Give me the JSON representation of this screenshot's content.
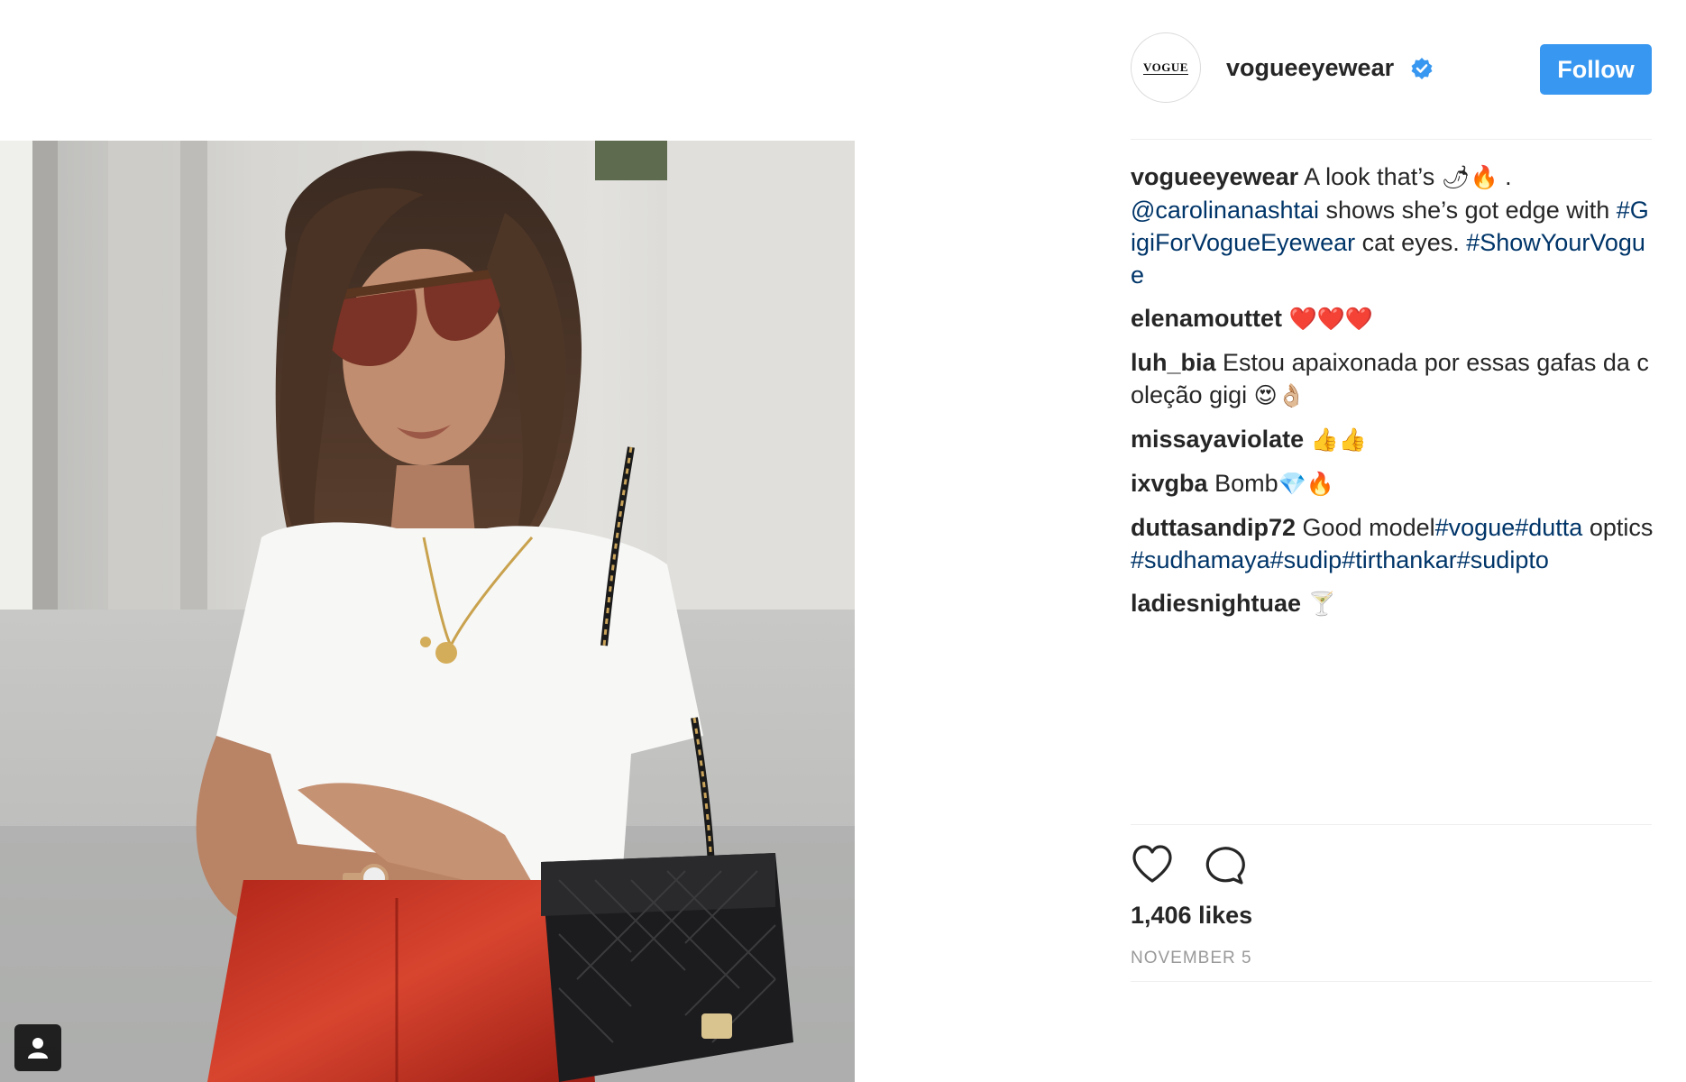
{
  "post": {
    "username": "vogueeyewear",
    "avatar_text": "VOGUE",
    "follow_label": "Follow",
    "caption": {
      "user": "vogueeyewear",
      "text1": "A look that’s",
      "emoji1": "🌶🔥",
      "text2": " .",
      "mention": "@carolinanashtai",
      "text3": " shows she’s got edge with ",
      "hashtag1": "#GigiForVogueEyewear",
      "text4": " cat eyes. ",
      "hashtag2": "#ShowYourVogue"
    },
    "comments": [
      {
        "user": "elenamouttet",
        "text": "",
        "emoji": "❤️❤️❤️"
      },
      {
        "user": "luh_bia",
        "text": "Estou apaixonada por essas gafas da coleção gigi",
        "emoji": "😍👌🏼"
      },
      {
        "user": "missayaviolate",
        "text": "",
        "emoji": "👍👍"
      },
      {
        "user": "ixvgba",
        "text": "Bomb",
        "emoji": "💎🔥"
      },
      {
        "user": "duttasandip72",
        "text": "Good model",
        "hashtags": [
          "#vogue",
          "#dutta"
        ],
        "text2": "optics",
        "hashtags2": [
          "#sudhamaya",
          "#sudip",
          "#tirthankar",
          "#sudipto"
        ]
      },
      {
        "user": "ladiesnightuae",
        "text": "",
        "emoji": "🍸"
      }
    ],
    "likes": "1,406 likes",
    "date": "NOVEMBER 5"
  },
  "icons": {
    "verified": "verified-badge-icon",
    "like": "heart-icon",
    "comment": "comment-bubble-icon",
    "tag": "tagged-user-icon"
  },
  "colors": {
    "follow_button": "#3897f0",
    "link": "#003569",
    "verified": "#3897f0",
    "muted": "#999999"
  }
}
